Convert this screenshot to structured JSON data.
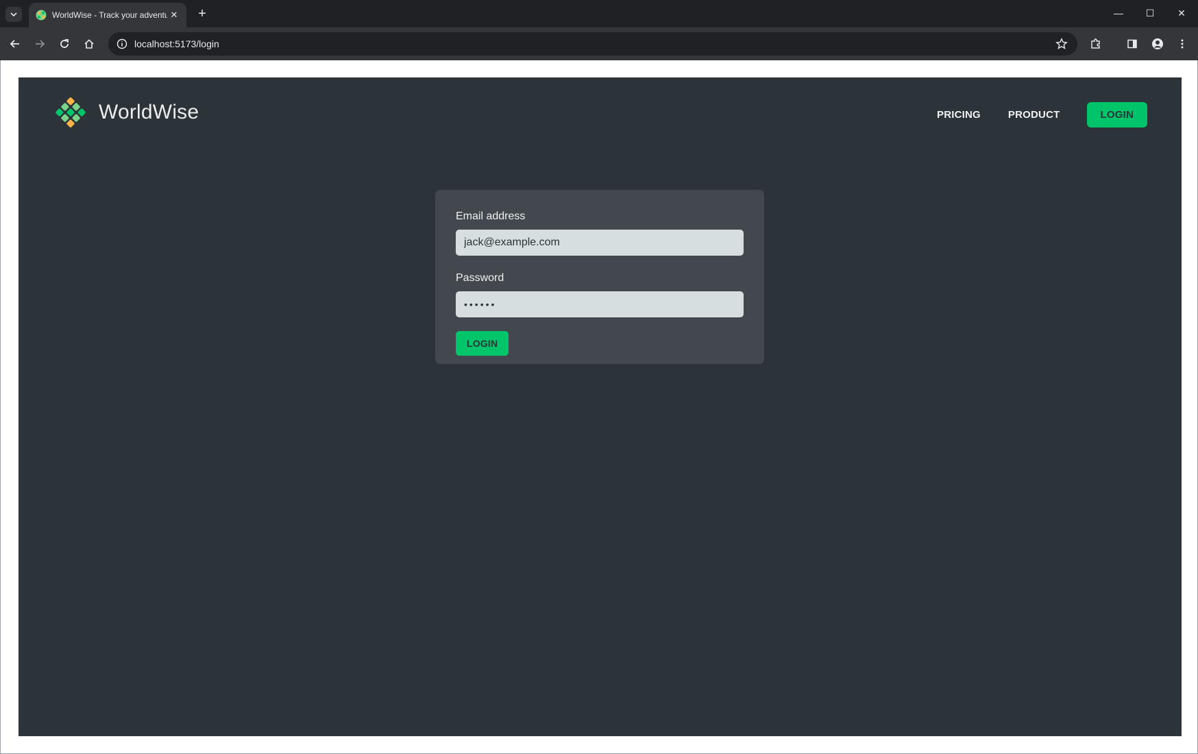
{
  "browser": {
    "tab_title": "WorldWise - Track your adventures",
    "tab_close": "✕",
    "new_tab": "+",
    "url": "localhost:5173/login",
    "win_minimize": "—",
    "win_maximize": "☐",
    "win_close": "✕"
  },
  "app": {
    "brand": "WorldWise",
    "nav": {
      "pricing": "PRICING",
      "product": "PRODUCT",
      "login": "LOGIN"
    },
    "form": {
      "email_label": "Email address",
      "email_value": "jack@example.com",
      "password_label": "Password",
      "password_masked": "••••••",
      "submit_label": "LOGIN"
    }
  },
  "colors": {
    "app_bg": "#2d3439",
    "card_bg": "#42484d",
    "accent": "#00c46a",
    "input_bg": "#d6dee0"
  }
}
